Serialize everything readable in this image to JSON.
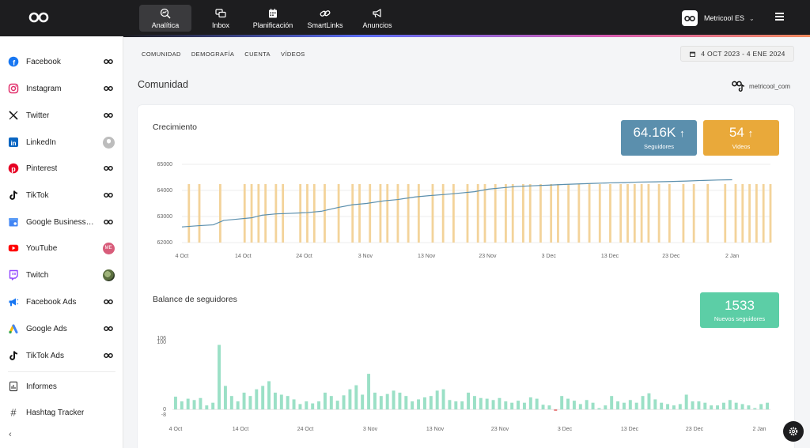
{
  "topbar": {
    "nav": [
      {
        "label": "Analítica",
        "icon": "analytics-icon",
        "active": true
      },
      {
        "label": "Inbox",
        "icon": "inbox-icon"
      },
      {
        "label": "Planificación",
        "icon": "calendar-icon"
      },
      {
        "label": "SmartLinks",
        "icon": "link-icon"
      },
      {
        "label": "Anuncios",
        "icon": "megaphone-icon"
      }
    ],
    "brand_name": "Metricool ES"
  },
  "sidebar": {
    "items": [
      {
        "label": "Facebook",
        "icon": "facebook-icon",
        "color": "#1877f2",
        "status": "linked-icon"
      },
      {
        "label": "Instagram",
        "icon": "instagram-icon",
        "color": "#e1306c",
        "status": "linked-icon"
      },
      {
        "label": "Twitter",
        "icon": "x-twitter-icon",
        "color": "#111111",
        "status": "linked-icon"
      },
      {
        "label": "LinkedIn",
        "icon": "linkedin-icon",
        "color": "#0a66c2",
        "status": "avatar-grey"
      },
      {
        "label": "Pinterest",
        "icon": "pinterest-icon",
        "color": "#e60023",
        "status": "linked-icon"
      },
      {
        "label": "TikTok",
        "icon": "tiktok-icon",
        "color": "#111111",
        "status": "linked-icon"
      },
      {
        "label": "Google Business Profile",
        "icon": "google-business-icon",
        "color": "#4285f4",
        "status": "linked-icon"
      },
      {
        "label": "YouTube",
        "icon": "youtube-icon",
        "color": "#ff0000",
        "status": "avatar-me",
        "avatar_text": "ME"
      },
      {
        "label": "Twitch",
        "icon": "twitch-icon",
        "color": "#9146ff",
        "status": "avatar-photo"
      },
      {
        "label": "Facebook Ads",
        "icon": "facebook-ads-icon",
        "color": "#1877f2",
        "status": "linked-icon"
      },
      {
        "label": "Google Ads",
        "icon": "google-ads-icon",
        "color": "#34a853",
        "status": "linked-icon"
      },
      {
        "label": "TikTok Ads",
        "icon": "tiktok-ads-icon",
        "color": "#111111",
        "status": "linked-icon"
      }
    ],
    "bottom": [
      {
        "label": "Informes",
        "icon": "reports-icon"
      },
      {
        "label": "Hashtag Tracker",
        "icon": "hashtag-icon"
      }
    ]
  },
  "subtabs": [
    "COMUNIDAD",
    "DEMOGRAFÍA",
    "CUENTA",
    "VÍDEOS"
  ],
  "date_range": "4 OCT 2023 - 4 ENE 2024",
  "section_title": "Comunidad",
  "account_handle": "metricool_com",
  "growth": {
    "title": "Crecimiento",
    "kpis": [
      {
        "value": "64.16K",
        "label": "Seguidores",
        "color": "#5b8fad"
      },
      {
        "value": "54",
        "label": "Videos",
        "color": "#e9a93a"
      }
    ]
  },
  "balance": {
    "title": "Balance de seguidores",
    "kpi": {
      "value": "1533",
      "label": "Nuevos seguidores",
      "color": "#5ccea6"
    }
  },
  "chart_data": [
    {
      "type": "line",
      "title": "Crecimiento",
      "x_tick_labels": [
        "4 Oct",
        "14 Oct",
        "24 Oct",
        "3 Nov",
        "13 Nov",
        "23 Nov",
        "3 Dec",
        "13 Dec",
        "23 Dec",
        "2 Jan"
      ],
      "y_tick_labels": [
        "65000",
        "64000",
        "63000",
        "62000"
      ],
      "ylim": [
        62000,
        65000
      ],
      "x_range_days": [
        0,
        92
      ],
      "grid": true,
      "series": [
        {
          "kind": "line",
          "color": "#5b8fad",
          "points": [
            [
              0,
              62600
            ],
            [
              5,
              62650
            ],
            [
              9,
              62680
            ],
            [
              12,
              62850
            ],
            [
              16,
              62900
            ],
            [
              20,
              62950
            ],
            [
              23,
              63050
            ],
            [
              27,
              63100
            ],
            [
              31,
              63120
            ],
            [
              36,
              63150
            ],
            [
              40,
              63200
            ],
            [
              45,
              63350
            ],
            [
              49,
              63450
            ],
            [
              53,
              63500
            ],
            [
              58,
              63600
            ],
            [
              62,
              63650
            ],
            [
              67,
              63750
            ],
            [
              71,
              63800
            ],
            [
              76,
              63850
            ],
            [
              80,
              63900
            ],
            [
              84,
              63950
            ],
            [
              88,
              64050
            ],
            [
              92,
              64100
            ],
            [
              96,
              64150
            ],
            [
              101,
              64180
            ],
            [
              105,
              64200
            ],
            [
              110,
              64230
            ],
            [
              114,
              64250
            ],
            [
              118,
              64270
            ],
            [
              123,
              64290
            ],
            [
              127,
              64300
            ],
            [
              131,
              64320
            ],
            [
              136,
              64330
            ],
            [
              140,
              64340
            ],
            [
              145,
              64360
            ],
            [
              149,
              64380
            ],
            [
              154,
              64400
            ],
            [
              158,
              64410
            ]
          ]
        },
        {
          "kind": "bar",
          "color": "#f3d39a",
          "x_days": [
            2,
            5,
            11,
            18,
            20,
            22,
            24,
            27,
            29,
            34,
            36,
            38,
            41,
            45,
            49,
            51,
            54,
            57,
            59,
            62,
            65,
            68,
            72,
            75,
            78,
            82,
            85,
            87,
            90,
            93,
            95,
            98,
            100,
            103,
            106,
            108,
            111,
            114,
            117,
            120,
            123,
            126,
            128,
            130,
            132,
            134,
            137,
            140,
            144,
            147,
            151,
            156,
            159,
            161,
            163,
            165,
            167,
            169
          ]
        }
      ]
    },
    {
      "type": "bar",
      "title": "Balance de seguidores",
      "x_tick_labels": [
        "4 Oct",
        "14 Oct",
        "24 Oct",
        "3 Nov",
        "13 Nov",
        "23 Nov",
        "3 Dec",
        "13 Dec",
        "23 Dec",
        "2 Jan"
      ],
      "y_tick_labels": [
        "106",
        "100",
        "0",
        "-8"
      ],
      "ylim": [
        -8,
        106
      ],
      "color": "#9be0c6",
      "values": [
        19,
        12,
        16,
        14,
        17,
        6,
        10,
        96,
        35,
        20,
        12,
        25,
        20,
        30,
        35,
        42,
        25,
        22,
        20,
        15,
        8,
        12,
        9,
        12,
        25,
        20,
        13,
        21,
        30,
        36,
        22,
        53,
        25,
        20,
        23,
        28,
        25,
        20,
        12,
        15,
        18,
        20,
        28,
        30,
        14,
        12,
        12,
        25,
        20,
        17,
        16,
        14,
        17,
        12,
        10,
        13,
        10,
        18,
        16,
        7,
        6,
        -2,
        20,
        16,
        13,
        8,
        14,
        10,
        2,
        6,
        20,
        12,
        10,
        14,
        10,
        20,
        24,
        15,
        10,
        8,
        6,
        8,
        22,
        12,
        12,
        10,
        6,
        6,
        10,
        14,
        10,
        8,
        6,
        2,
        8,
        10
      ]
    }
  ]
}
